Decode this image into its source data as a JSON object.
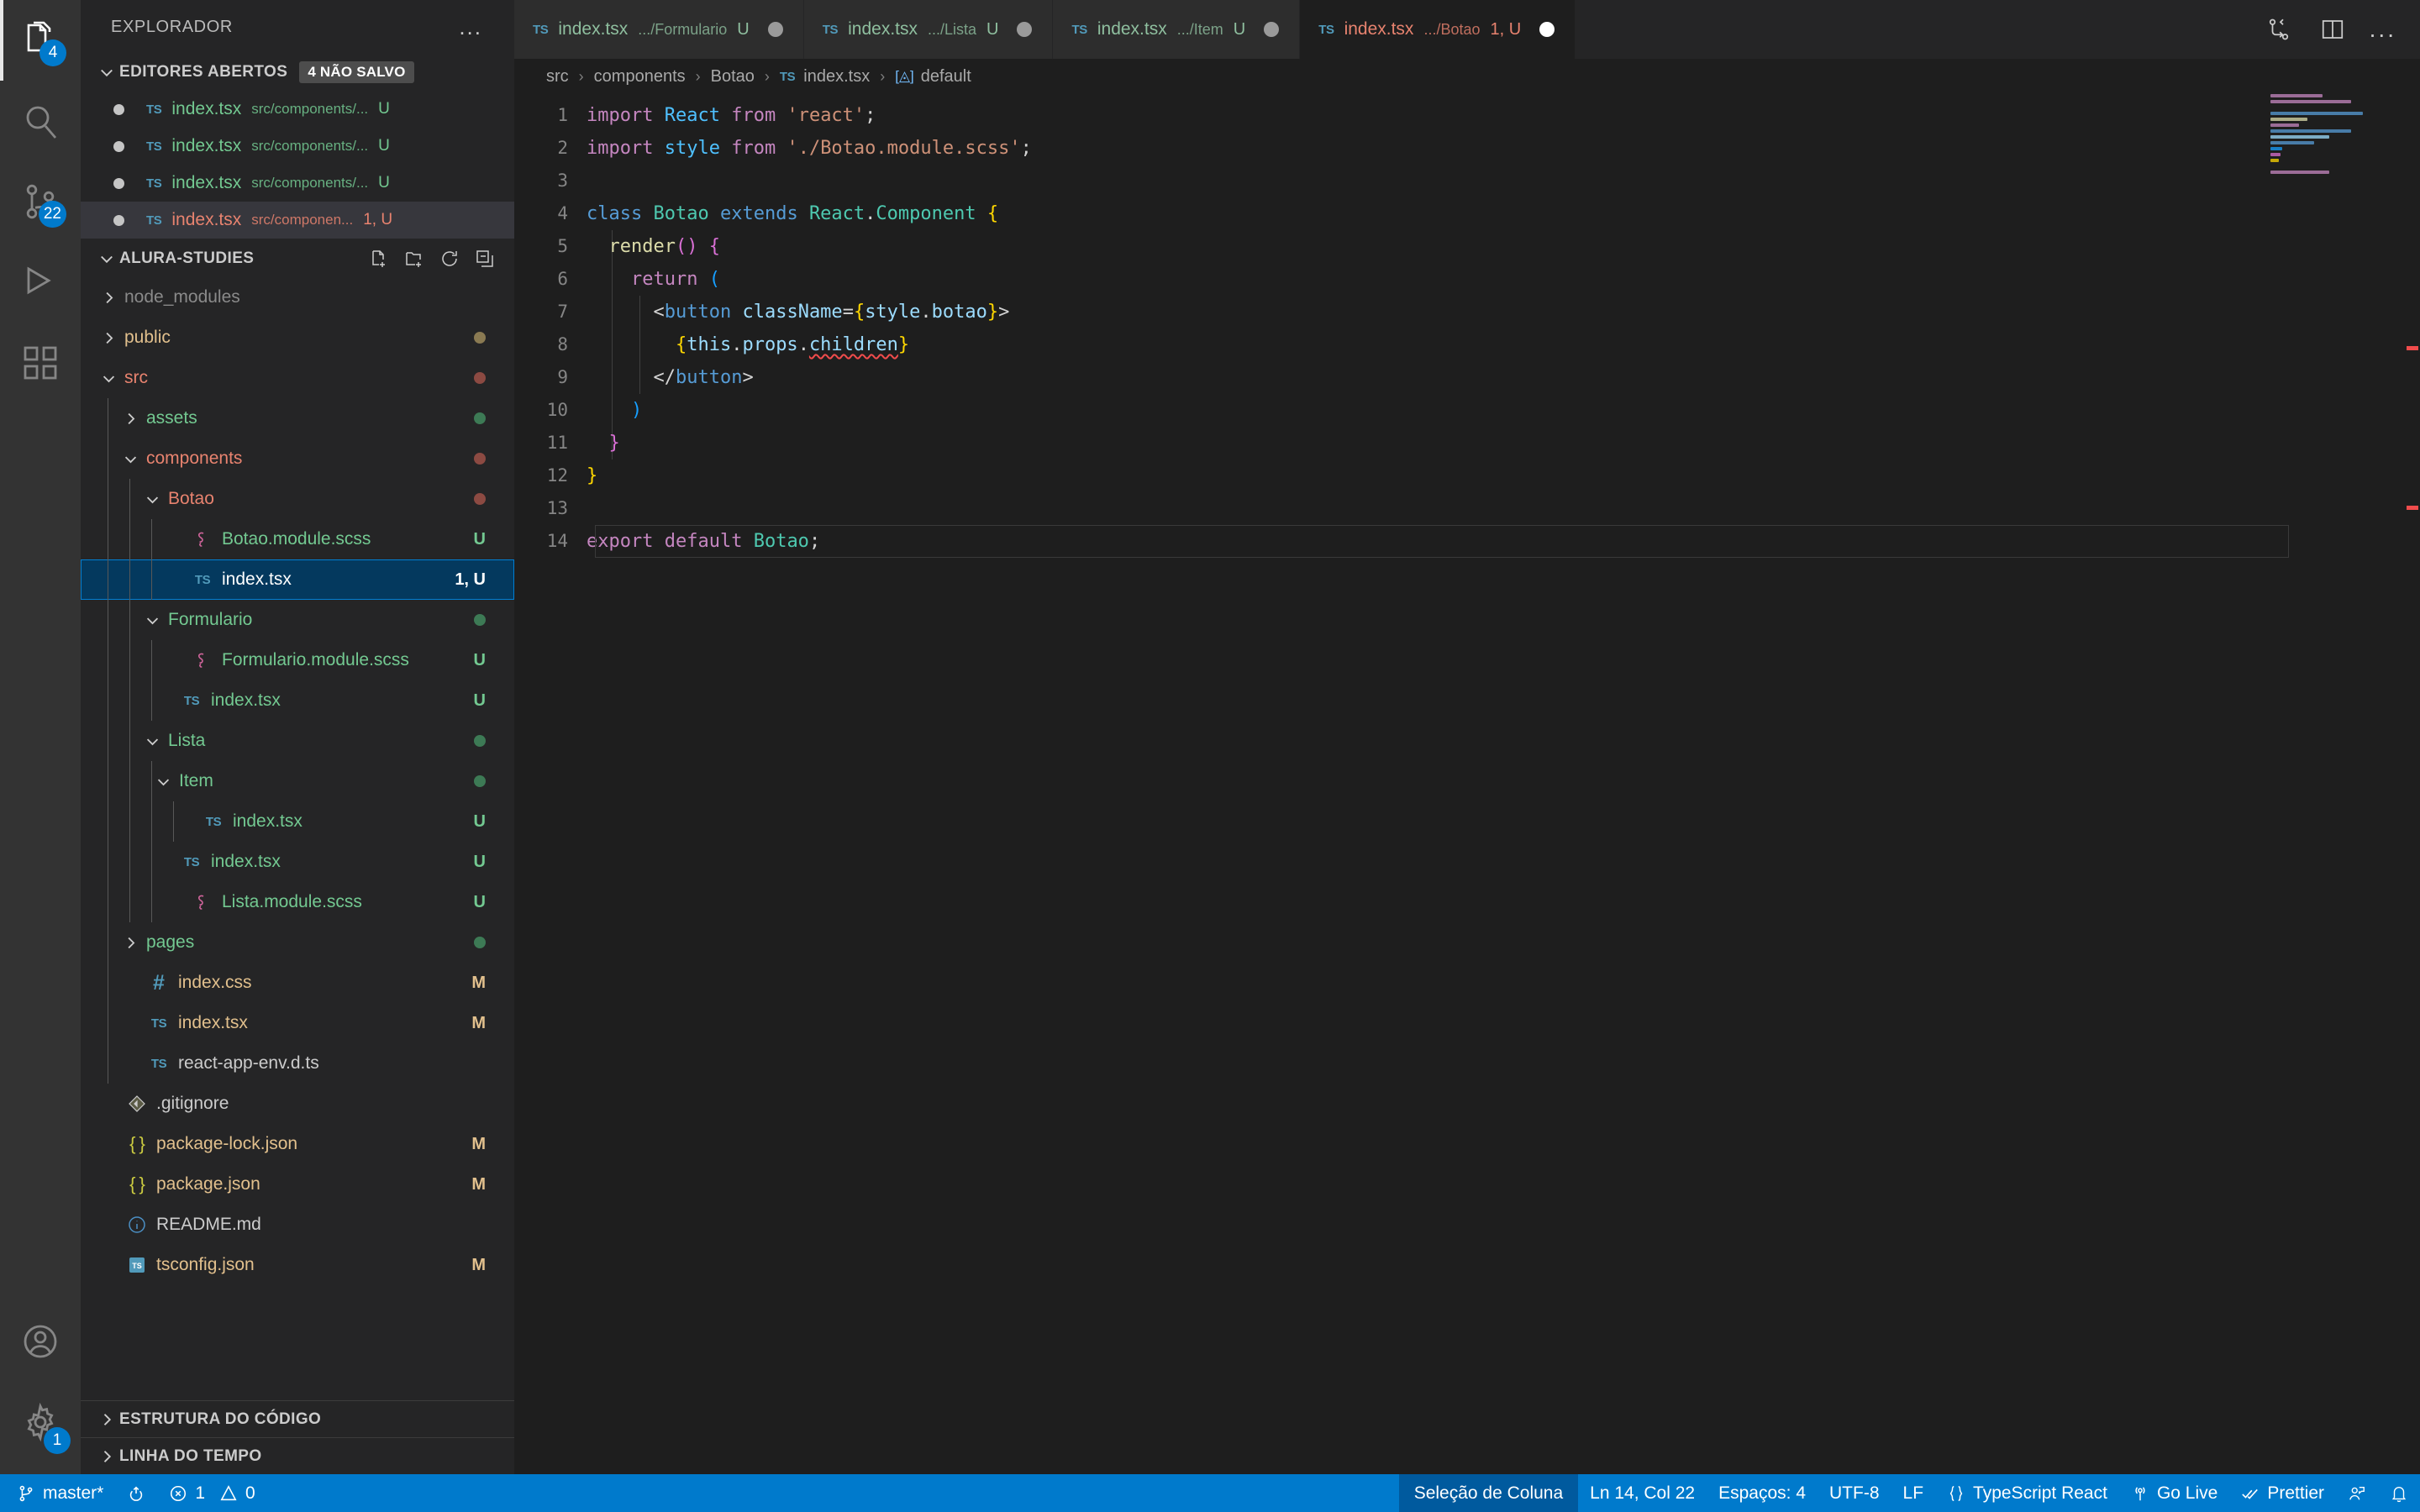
{
  "activitybar": {
    "items": [
      {
        "name": "explorer",
        "icon": "files-icon",
        "badge": "4",
        "active": true
      },
      {
        "name": "search",
        "icon": "search-icon",
        "badge": "",
        "active": false
      },
      {
        "name": "source-control",
        "icon": "source-control-icon",
        "badge": "22",
        "active": false
      },
      {
        "name": "run-and-debug",
        "icon": "debug-icon",
        "badge": "",
        "active": false
      },
      {
        "name": "extensions",
        "icon": "extensions-icon",
        "badge": "",
        "active": false
      }
    ],
    "bottom": [
      {
        "name": "accounts",
        "icon": "account-icon",
        "badge": ""
      },
      {
        "name": "manage",
        "icon": "gear-icon",
        "badge": "1"
      }
    ]
  },
  "sidebar": {
    "title": "EXPLORADOR",
    "more_actions": "...",
    "open_editors": {
      "label": "EDITORES ABERTOS",
      "badge": "4 NÃO SALVO",
      "items": [
        {
          "name": "index.tsx",
          "path": "src/components/...",
          "status": "U",
          "selected": false,
          "modified": true
        },
        {
          "name": "index.tsx",
          "path": "src/components/...",
          "status": "U",
          "selected": false,
          "modified": true
        },
        {
          "name": "index.tsx",
          "path": "src/components/...",
          "status": "U",
          "selected": false,
          "modified": true
        },
        {
          "name": "index.tsx",
          "path": "src/componen...",
          "status": "1, U",
          "selected": true,
          "modified": true
        }
      ]
    },
    "project": {
      "label": "ALURA-STUDIES",
      "actions": [
        "new-file-icon",
        "new-folder-icon",
        "refresh-icon",
        "collapse-all-icon"
      ],
      "tree": [
        {
          "label": "node_modules",
          "type": "folder",
          "depth": 1,
          "expanded": false,
          "icon": "chevron-right-icon",
          "color": "#8a8a8a",
          "badge": "",
          "dot": ""
        },
        {
          "label": "public",
          "type": "folder",
          "depth": 1,
          "expanded": false,
          "icon": "chevron-right-icon",
          "color": "#e2c08d",
          "badge": "",
          "dot": "#8a7a52"
        },
        {
          "label": "src",
          "type": "folder",
          "depth": 1,
          "expanded": true,
          "icon": "chevron-down-icon",
          "color": "#e8836f",
          "badge": "",
          "dot": "#8c4a42"
        },
        {
          "label": "assets",
          "type": "folder",
          "depth": 2,
          "expanded": false,
          "icon": "chevron-right-icon",
          "color": "#73c991",
          "badge": "",
          "dot": "#3d7a55"
        },
        {
          "label": "components",
          "type": "folder",
          "depth": 2,
          "expanded": true,
          "icon": "chevron-down-icon",
          "color": "#e8836f",
          "badge": "",
          "dot": "#8c4a42"
        },
        {
          "label": "Botao",
          "type": "folder",
          "depth": 3,
          "expanded": true,
          "icon": "chevron-down-icon",
          "color": "#e8836f",
          "badge": "",
          "dot": "#8c4a42"
        },
        {
          "label": "Botao.module.scss",
          "type": "scss",
          "depth": 4,
          "expanded": false,
          "icon": "scss-icon",
          "color": "#73c991",
          "badge": "U",
          "dot": ""
        },
        {
          "label": "index.tsx",
          "type": "tsx",
          "depth": 4,
          "expanded": false,
          "icon": "ts-icon",
          "color": "#ffffff",
          "badge": "1, U",
          "dot": "",
          "selected": true
        },
        {
          "label": "Formulario",
          "type": "folder",
          "depth": 3,
          "expanded": true,
          "icon": "chevron-down-icon",
          "color": "#73c991",
          "badge": "",
          "dot": "#3d7a55"
        },
        {
          "label": "Formulario.module.scss",
          "type": "scss",
          "depth": 4,
          "expanded": false,
          "icon": "scss-icon",
          "color": "#73c991",
          "badge": "U",
          "dot": ""
        },
        {
          "label": "index.tsx",
          "type": "tsx",
          "depth": 3.5,
          "expanded": false,
          "icon": "ts-icon",
          "color": "#73c991",
          "badge": "U",
          "dot": ""
        },
        {
          "label": "Lista",
          "type": "folder",
          "depth": 3,
          "expanded": true,
          "icon": "chevron-down-icon",
          "color": "#73c991",
          "badge": "",
          "dot": "#3d7a55"
        },
        {
          "label": "Item",
          "type": "folder",
          "depth": 3.5,
          "expanded": true,
          "icon": "chevron-down-icon",
          "color": "#73c991",
          "badge": "",
          "dot": "#3d7a55"
        },
        {
          "label": "index.tsx",
          "type": "tsx",
          "depth": 4.5,
          "expanded": false,
          "icon": "ts-icon",
          "color": "#73c991",
          "badge": "U",
          "dot": ""
        },
        {
          "label": "index.tsx",
          "type": "tsx",
          "depth": 3.5,
          "expanded": false,
          "icon": "ts-icon",
          "color": "#73c991",
          "badge": "U",
          "dot": ""
        },
        {
          "label": "Lista.module.scss",
          "type": "scss",
          "depth": 4,
          "expanded": false,
          "icon": "scss-icon",
          "color": "#73c991",
          "badge": "U",
          "dot": ""
        },
        {
          "label": "pages",
          "type": "folder",
          "depth": 2,
          "expanded": false,
          "icon": "chevron-right-icon",
          "color": "#73c991",
          "badge": "",
          "dot": "#3d7a55"
        },
        {
          "label": "index.css",
          "type": "css",
          "depth": 2,
          "expanded": false,
          "icon": "css-icon",
          "color": "#e2c08d",
          "badge": "M",
          "dot": ""
        },
        {
          "label": "index.tsx",
          "type": "tsx",
          "depth": 2,
          "expanded": false,
          "icon": "ts-icon",
          "color": "#e2c08d",
          "badge": "M",
          "dot": ""
        },
        {
          "label": "react-app-env.d.ts",
          "type": "ts",
          "depth": 2,
          "expanded": false,
          "icon": "ts-icon",
          "color": "#cccccc",
          "badge": "",
          "dot": ""
        },
        {
          "label": ".gitignore",
          "type": "git",
          "depth": 1,
          "expanded": false,
          "icon": "git-icon",
          "color": "#cccccc",
          "badge": "",
          "dot": ""
        },
        {
          "label": "package-lock.json",
          "type": "json",
          "depth": 1,
          "expanded": false,
          "icon": "json-icon",
          "color": "#e2c08d",
          "badge": "M",
          "dot": ""
        },
        {
          "label": "package.json",
          "type": "json",
          "depth": 1,
          "expanded": false,
          "icon": "json-icon",
          "color": "#e2c08d",
          "badge": "M",
          "dot": ""
        },
        {
          "label": "README.md",
          "type": "md",
          "depth": 1,
          "expanded": false,
          "icon": "info-icon",
          "color": "#cccccc",
          "badge": "",
          "dot": ""
        },
        {
          "label": "tsconfig.json",
          "type": "tsconfig",
          "depth": 1,
          "expanded": false,
          "icon": "tsconfig-icon",
          "color": "#e2c08d",
          "badge": "M",
          "dot": ""
        }
      ]
    },
    "panels": [
      {
        "label": "ESTRUTURA DO CÓDIGO"
      },
      {
        "label": "LINHA DO TEMPO"
      }
    ]
  },
  "tabs": [
    {
      "name": "index.tsx",
      "desc": ".../Formulario",
      "status": "U",
      "active": false,
      "dirty": true
    },
    {
      "name": "index.tsx",
      "desc": ".../Lista",
      "status": "U",
      "active": false,
      "dirty": true
    },
    {
      "name": "index.tsx",
      "desc": ".../Item",
      "status": "U",
      "active": false,
      "dirty": true
    },
    {
      "name": "index.tsx",
      "desc": ".../Botao",
      "status": "1, U",
      "active": true,
      "dirty": true
    }
  ],
  "tabs_actions": [
    {
      "name": "split-diff-icon"
    },
    {
      "name": "split-editor-icon"
    },
    {
      "name": "more-actions-icon",
      "label": "..."
    }
  ],
  "breadcrumbs": [
    {
      "label": "src",
      "icon": ""
    },
    {
      "label": "components",
      "icon": ""
    },
    {
      "label": "Botao",
      "icon": ""
    },
    {
      "label": "index.tsx",
      "icon": "ts-icon"
    },
    {
      "label": "default",
      "icon": "symbol-icon"
    }
  ],
  "editor": {
    "language": "TypeScript React",
    "lines": [
      {
        "n": 1,
        "text": "import React from 'react';"
      },
      {
        "n": 2,
        "text": "import style from './Botao.module.scss';"
      },
      {
        "n": 3,
        "text": ""
      },
      {
        "n": 4,
        "text": "class Botao extends React.Component {"
      },
      {
        "n": 5,
        "text": "  render() {"
      },
      {
        "n": 6,
        "text": "    return ("
      },
      {
        "n": 7,
        "text": "      <button className={style.botao}>"
      },
      {
        "n": 8,
        "text": "        {this.props.children}"
      },
      {
        "n": 9,
        "text": "      </button>"
      },
      {
        "n": 10,
        "text": "    )"
      },
      {
        "n": 11,
        "text": "  }"
      },
      {
        "n": 12,
        "text": "}"
      },
      {
        "n": 13,
        "text": ""
      },
      {
        "n": 14,
        "text": "export default Botao;"
      }
    ]
  },
  "statusbar": {
    "left": [
      {
        "name": "branch",
        "icon": "source-control-icon",
        "label": "master*"
      },
      {
        "name": "sync",
        "icon": "sync-icon",
        "label": ""
      },
      {
        "name": "problems",
        "icon": "error-warning-icon",
        "label": "1",
        "label2": "0"
      }
    ],
    "right": [
      {
        "name": "column-selection",
        "icon": "",
        "label": "Seleção de Coluna",
        "highlight": true
      },
      {
        "name": "cursor-position",
        "icon": "",
        "label": "Ln 14, Col 22"
      },
      {
        "name": "indentation",
        "icon": "",
        "label": "Espaços: 4"
      },
      {
        "name": "encoding",
        "icon": "",
        "label": "UTF-8"
      },
      {
        "name": "eol",
        "icon": "",
        "label": "LF"
      },
      {
        "name": "language-mode",
        "icon": "json-brace-icon",
        "label": "TypeScript React"
      },
      {
        "name": "go-live",
        "icon": "broadcast-icon",
        "label": "Go Live"
      },
      {
        "name": "prettier",
        "icon": "check-all-icon",
        "label": "Prettier"
      },
      {
        "name": "remote-feedback",
        "icon": "feedback-icon",
        "label": ""
      },
      {
        "name": "notifications",
        "icon": "bell-icon",
        "label": ""
      }
    ]
  }
}
